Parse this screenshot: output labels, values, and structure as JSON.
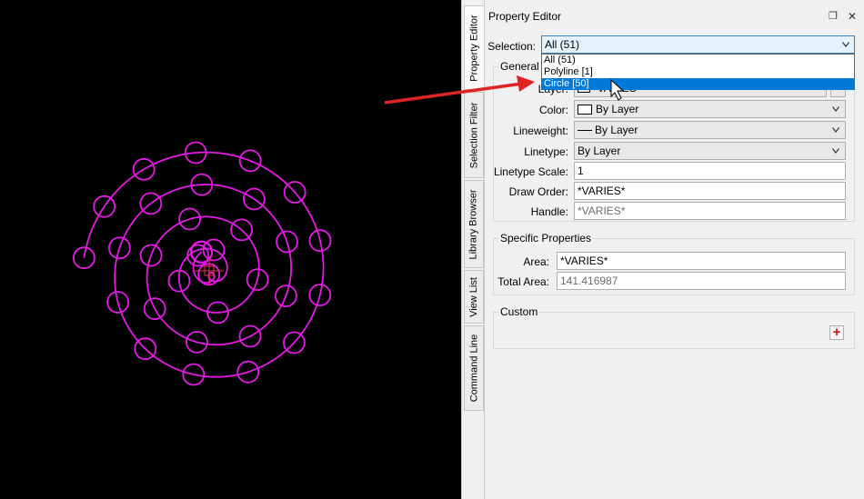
{
  "tabs": [
    "Property Editor",
    "Selection Filter",
    "Library Browser",
    "View List",
    "Command Line"
  ],
  "panel": {
    "title": "Property Editor",
    "selection_label": "Selection:",
    "selection_value": "All (51)",
    "dropdown_options": [
      "All (51)",
      "Polyline [1]",
      "Circle [50]"
    ]
  },
  "general": {
    "title": "General Properties",
    "layer_label": "Layer:",
    "layer_value": "*VARIES*",
    "color_label": "Color:",
    "color_value": "By Layer",
    "lineweight_label": "Lineweight:",
    "lineweight_value": "By Layer",
    "linetype_label": "Linetype:",
    "linetype_value": "By Layer",
    "linetype_scale_label": "Linetype Scale:",
    "linetype_scale_value": "1",
    "draw_order_label": "Draw Order:",
    "draw_order_value": "*VARIES*",
    "handle_label": "Handle:",
    "handle_value": "*VARIES*"
  },
  "specific": {
    "title": "Specific Properties",
    "area_label": "Area:",
    "area_value": "*VARIES*",
    "total_area_label": "Total Area:",
    "total_area_value": "141.416987"
  },
  "custom": {
    "title": "Custom"
  },
  "colors": {
    "drawing": "#e619e6",
    "canvas": "#000000",
    "accent": "#0078d7",
    "arrow": "#e02424"
  }
}
